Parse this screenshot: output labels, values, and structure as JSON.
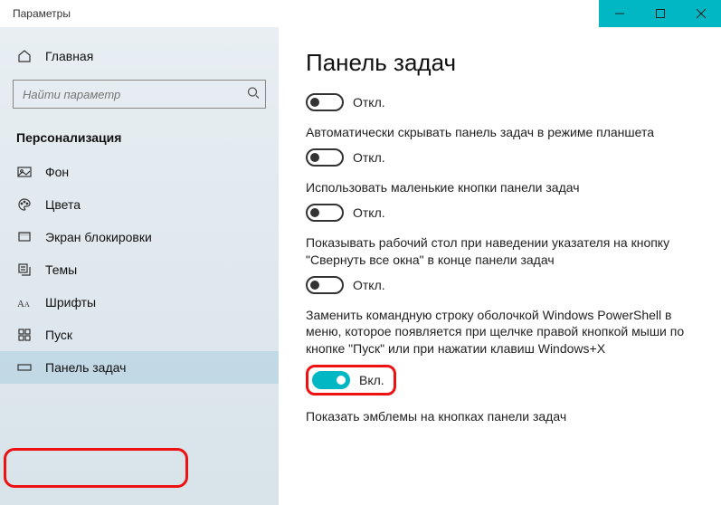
{
  "window": {
    "title": "Параметры"
  },
  "sidebar": {
    "home": "Главная",
    "search_placeholder": "Найти параметр",
    "section": "Персонализация",
    "items": [
      {
        "label": "Фон"
      },
      {
        "label": "Цвета"
      },
      {
        "label": "Экран блокировки"
      },
      {
        "label": "Темы"
      },
      {
        "label": "Шрифты"
      },
      {
        "label": "Пуск"
      },
      {
        "label": "Панель задач"
      }
    ]
  },
  "content": {
    "title": "Панель задач",
    "settings": [
      {
        "desc": "",
        "state": "Откл."
      },
      {
        "desc": "Автоматически скрывать панель задач в режиме планшета",
        "state": "Откл."
      },
      {
        "desc": "Использовать маленькие кнопки панели задач",
        "state": "Откл."
      },
      {
        "desc": "Показывать рабочий стол при наведении указателя на кнопку \"Свернуть все окна\" в конце панели задач",
        "state": "Откл."
      },
      {
        "desc": "Заменить командную строку оболочкой Windows PowerShell в меню, которое появляется при щелчке правой кнопкой мыши по кнопке \"Пуск\" или при нажатии клавиш Windows+X",
        "state": "Вкл."
      },
      {
        "desc": "Показать эмблемы на кнопках панели задач",
        "state": ""
      }
    ]
  }
}
